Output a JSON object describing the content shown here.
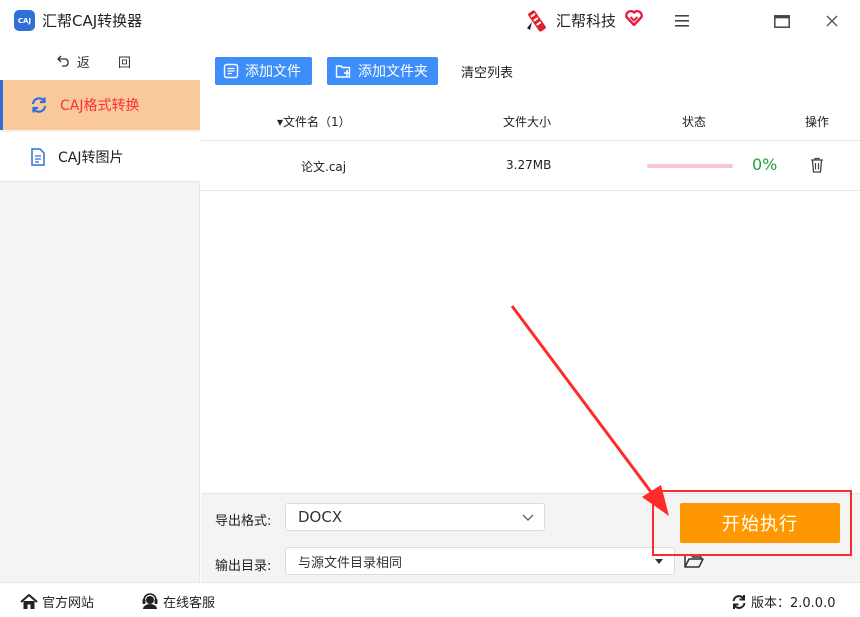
{
  "app": {
    "logo_text": "CAJ",
    "title": "汇帮CAJ转换器",
    "brand": "汇帮科技"
  },
  "sidebar": {
    "back_label": "返 回",
    "items": [
      {
        "label": "CAJ格式转换",
        "icon": "refresh-icon",
        "active": true
      },
      {
        "label": "CAJ转图片",
        "icon": "document-icon",
        "active": false
      }
    ]
  },
  "toolbar": {
    "add_file": "添加文件",
    "add_folder": "添加文件夹",
    "clear_list": "清空列表"
  },
  "table": {
    "headers": {
      "name": "▾文件名（1）",
      "size": "文件大小",
      "status": "状态",
      "action": "操作"
    },
    "rows": [
      {
        "name": "论文.caj",
        "size": "3.27MB",
        "progress": 0,
        "progress_text": "0%"
      }
    ]
  },
  "settings": {
    "format_label": "导出格式:",
    "format_value": "DOCX",
    "dir_label": "输出目录:",
    "dir_value": "与源文件目录相同",
    "start_button": "开始执行"
  },
  "statusbar": {
    "website": "官方网站",
    "service": "在线客服",
    "version": "版本：2.0.0.0"
  },
  "colors": {
    "accent_blue": "#3d8ef8",
    "active_nav_bg": "#f9c99c",
    "active_nav_text": "#ff3030",
    "start_button": "#ff9800",
    "progress_text": "#21a03a",
    "annotation_red": "#ff2a2a"
  }
}
